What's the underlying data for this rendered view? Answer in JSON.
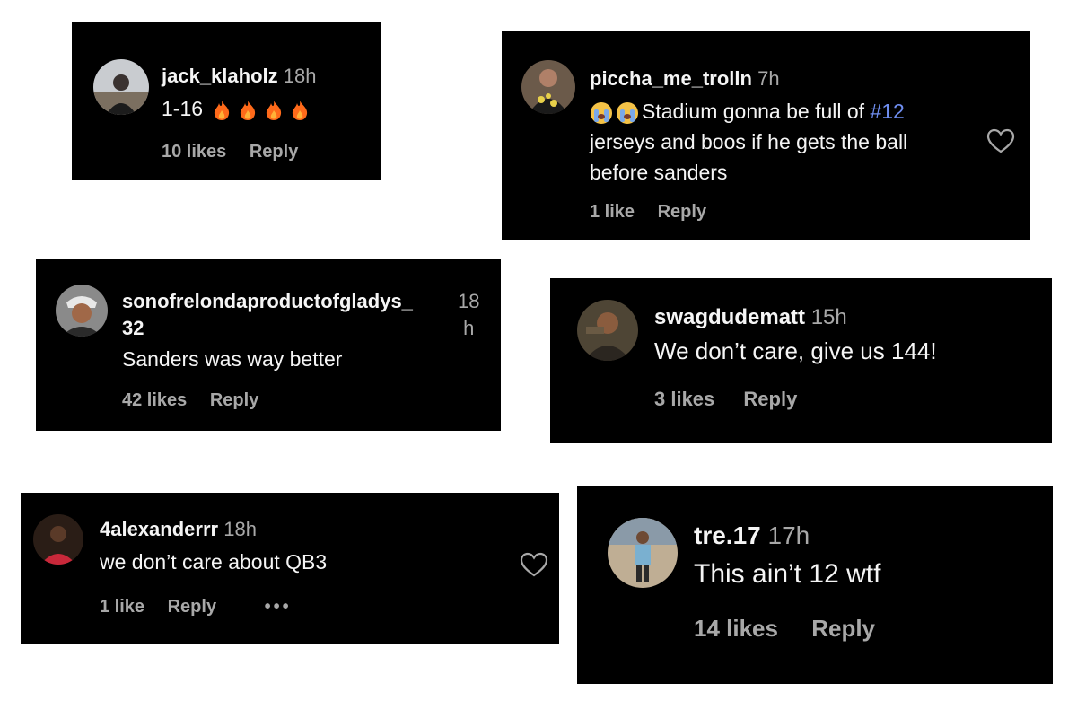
{
  "comments": [
    {
      "username": "jack_klaholz",
      "time": "18h",
      "text": "1-16",
      "emojis": [
        "fire",
        "fire",
        "fire",
        "fire"
      ],
      "likes": "10 likes",
      "reply": "Reply"
    },
    {
      "username": "piccha_me_trolln",
      "time": "7h",
      "text_before": "Stadium gonna be full of ",
      "hashtag": "#12",
      "line2": "jerseys and boos if he gets the ball",
      "line3": "before sanders",
      "emojis": [
        "loudly-crying-face",
        "loudly-crying-face"
      ],
      "likes": "1 like",
      "reply": "Reply"
    },
    {
      "username_line1": "sonofrelondaproductofgladys_",
      "username_line2": "32",
      "time_line1": "18",
      "time_line2": "h",
      "text": "Sanders was way better",
      "likes": "42 likes",
      "reply": "Reply"
    },
    {
      "username": "swagdudematt",
      "time": "15h",
      "text": "We don’t care, give us 144!",
      "likes": "3 likes",
      "reply": "Reply"
    },
    {
      "username": "4alexanderrr",
      "time": "18h",
      "text": "we don’t care about QB3",
      "likes": "1 like",
      "reply": "Reply",
      "more": "•••"
    },
    {
      "username": "tre.17",
      "time": "17h",
      "text": "This ain’t 12 wtf",
      "likes": "14 likes",
      "reply": "Reply"
    }
  ],
  "colors": {
    "card_bg": "#000000",
    "text": "#f5f5f5",
    "muted": "#a8a8a8",
    "hashtag": "#6f8ef0",
    "fire": "#ff6a1a"
  }
}
